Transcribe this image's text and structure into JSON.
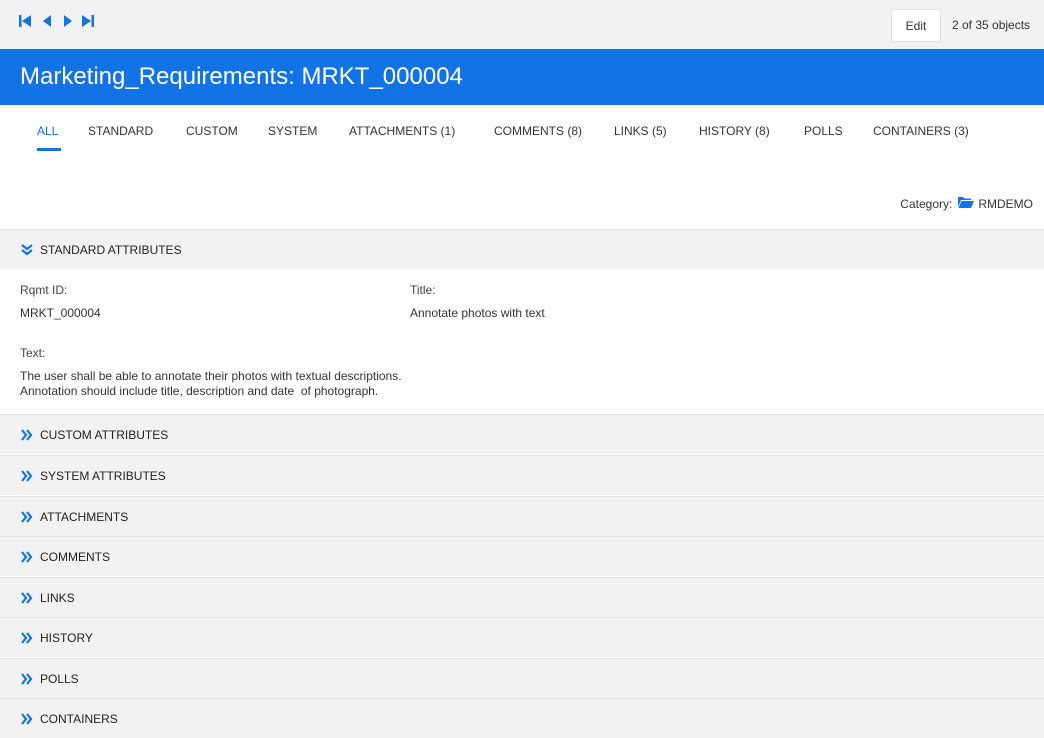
{
  "toolbar": {
    "nav_buttons": [
      "first-icon",
      "previous-icon",
      "next-icon",
      "last-icon"
    ],
    "edit_label": "Edit",
    "object_count": "2 of 35 objects"
  },
  "header": {
    "title": "Marketing_Requirements: MRKT_000004"
  },
  "tabs": [
    {
      "label": "ALL",
      "active": true
    },
    {
      "label": "STANDARD"
    },
    {
      "label": "CUSTOM"
    },
    {
      "label": "SYSTEM"
    },
    {
      "label": "ATTACHMENTS (1)"
    },
    {
      "label": "COMMENTS (8)"
    },
    {
      "label": "LINKS (5)"
    },
    {
      "label": "HISTORY (8)"
    },
    {
      "label": "POLLS"
    },
    {
      "label": "CONTAINERS (3)"
    }
  ],
  "category": {
    "label": "Category:",
    "value": "RMDEMO",
    "icon": "folder-open-icon"
  },
  "standard": {
    "header": "STANDARD ATTRIBUTES",
    "expanded": true,
    "rqmt_id_label": "Rqmt ID:",
    "rqmt_id_value": "MRKT_000004",
    "title_label": "Title:",
    "title_value": "Annotate photos with text",
    "text_label": "Text:",
    "text_lines": [
      "The user shall be able to annotate their photos with textual descriptions.",
      "Annotation should include title, description and date  of photograph."
    ]
  },
  "sections": [
    {
      "label": "CUSTOM ATTRIBUTES"
    },
    {
      "label": "SYSTEM ATTRIBUTES"
    },
    {
      "label": "ATTACHMENTS"
    },
    {
      "label": "COMMENTS"
    },
    {
      "label": "LINKS"
    },
    {
      "label": "HISTORY"
    },
    {
      "label": "POLLS"
    },
    {
      "label": "CONTAINERS"
    }
  ],
  "colors": {
    "accent": "#1173e6",
    "header_bg": "#f2f2f2"
  }
}
